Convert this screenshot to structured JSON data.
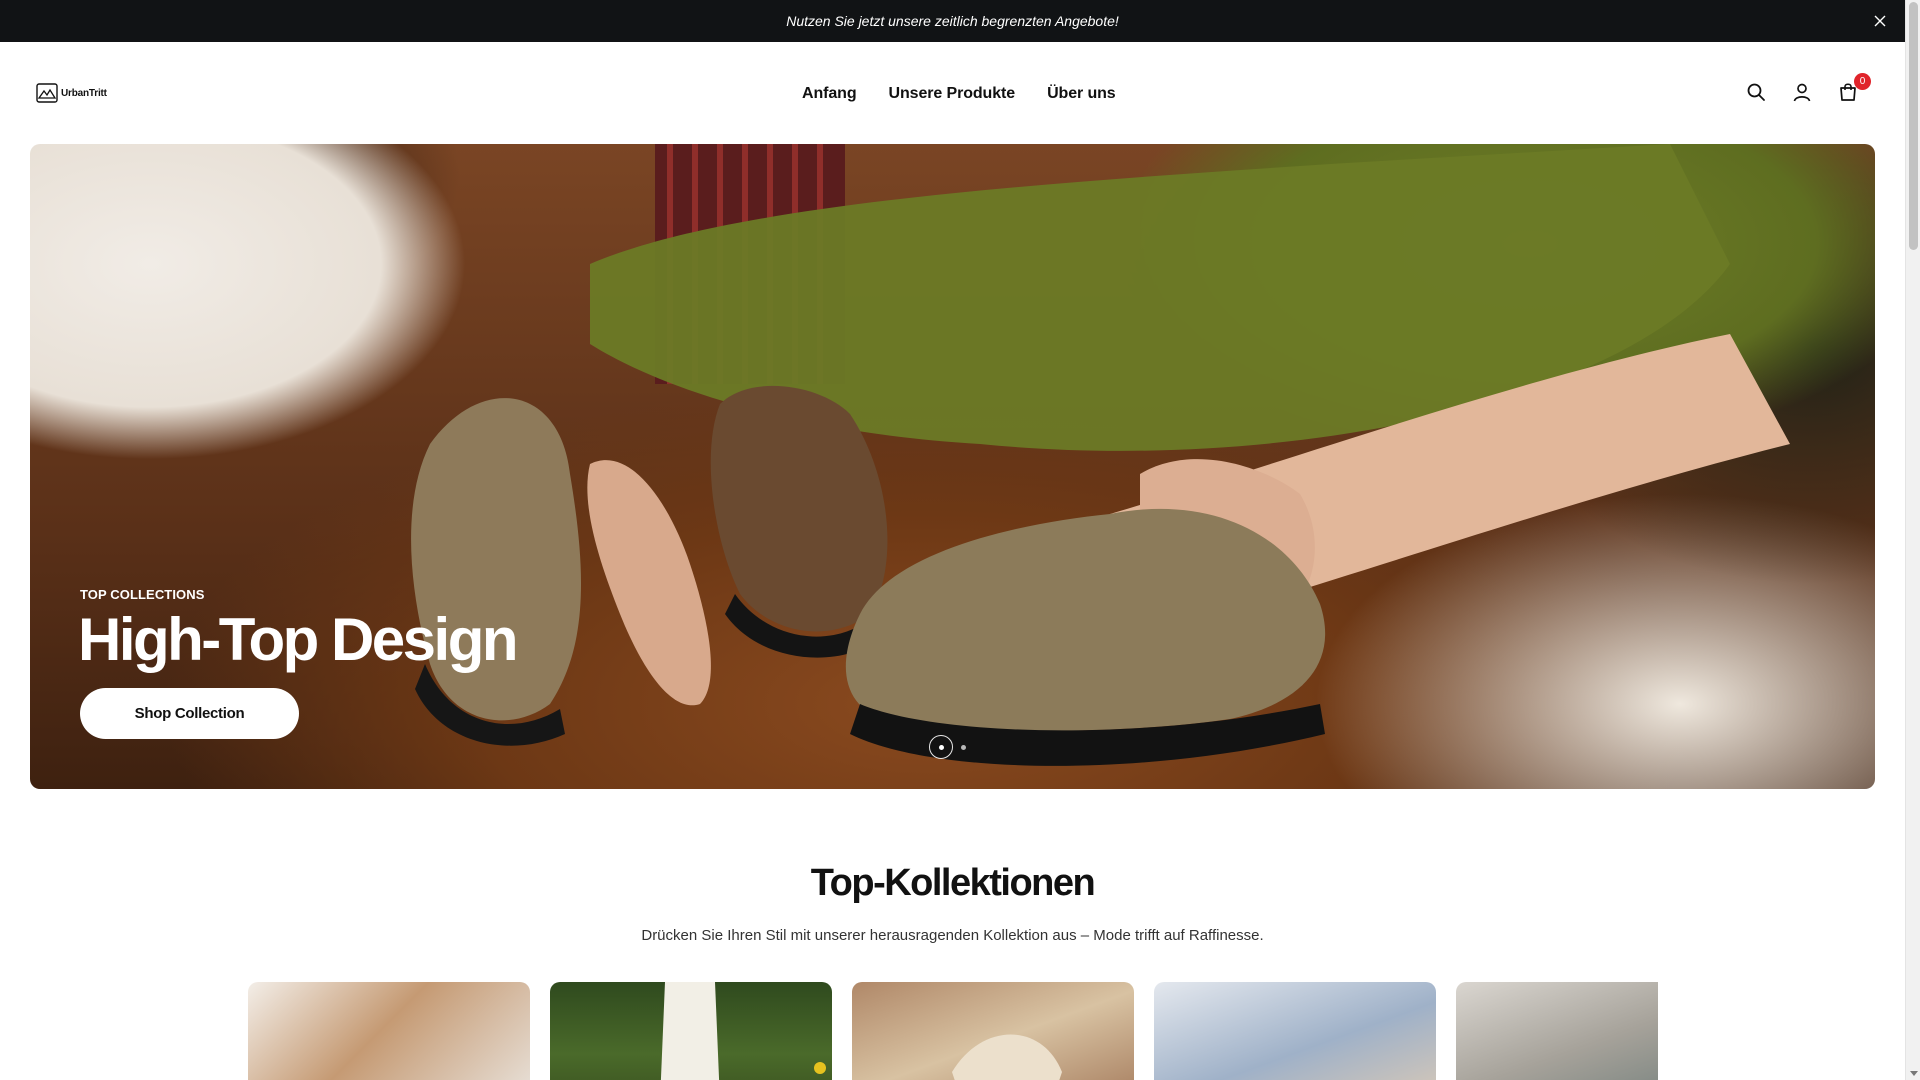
{
  "announcement": {
    "text": "Nutzen Sie jetzt unsere zeitlich begrenzten Angebote!",
    "close_icon": "close-icon"
  },
  "header": {
    "logo_text": "UrbanTritt",
    "nav": [
      "Anfang",
      "Unsere Produkte",
      "Über uns"
    ],
    "icons": [
      "search-icon",
      "account-icon",
      "cart-icon"
    ],
    "cart_count": "0"
  },
  "hero": {
    "eyebrow": "TOP COLLECTIONS",
    "title": "High-Top Design",
    "button_label": "Shop Collection",
    "slides_total": 2,
    "active_slide": 1
  },
  "collections": {
    "title": "Top-Kollektionen",
    "subtitle": "Drücken Sie Ihren Stil mit unserer herausragenden Kollektion aus – Mode trifft auf Raffinesse."
  },
  "colors": {
    "announcement_bg": "#111315",
    "cart_badge": "#e0242b",
    "text": "#111111"
  }
}
